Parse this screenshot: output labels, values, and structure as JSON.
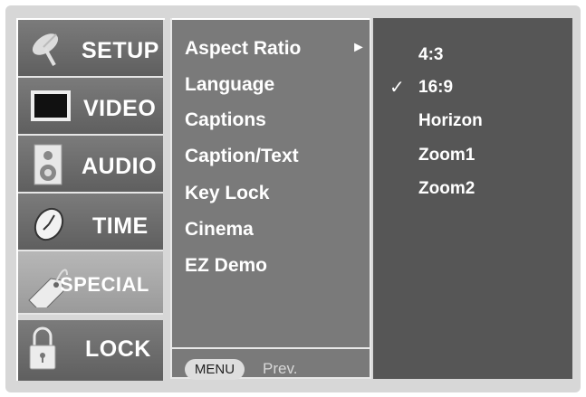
{
  "categories": [
    {
      "label": "SETUP",
      "icon": "satellite-dish-icon"
    },
    {
      "label": "VIDEO",
      "icon": "tv-screen-icon"
    },
    {
      "label": "AUDIO",
      "icon": "speaker-icon"
    },
    {
      "label": "TIME",
      "icon": "clock-icon"
    },
    {
      "label": "SPECIAL",
      "icon": "tag-icon",
      "selected": true
    },
    {
      "label": "LOCK",
      "icon": "padlock-icon"
    }
  ],
  "submenu": {
    "items": [
      "Aspect Ratio",
      "Language",
      "Captions",
      "Caption/Text",
      "Key Lock",
      "Cinema",
      "EZ Demo"
    ],
    "selected_index": 0,
    "arrow": "►"
  },
  "options": {
    "items": [
      "4:3",
      "16:9",
      "Horizon",
      "Zoom1",
      "Zoom2"
    ],
    "checked_index": 1,
    "check_mark": "✓"
  },
  "footer": {
    "menu_label": "MENU",
    "prev_label": "Prev."
  }
}
